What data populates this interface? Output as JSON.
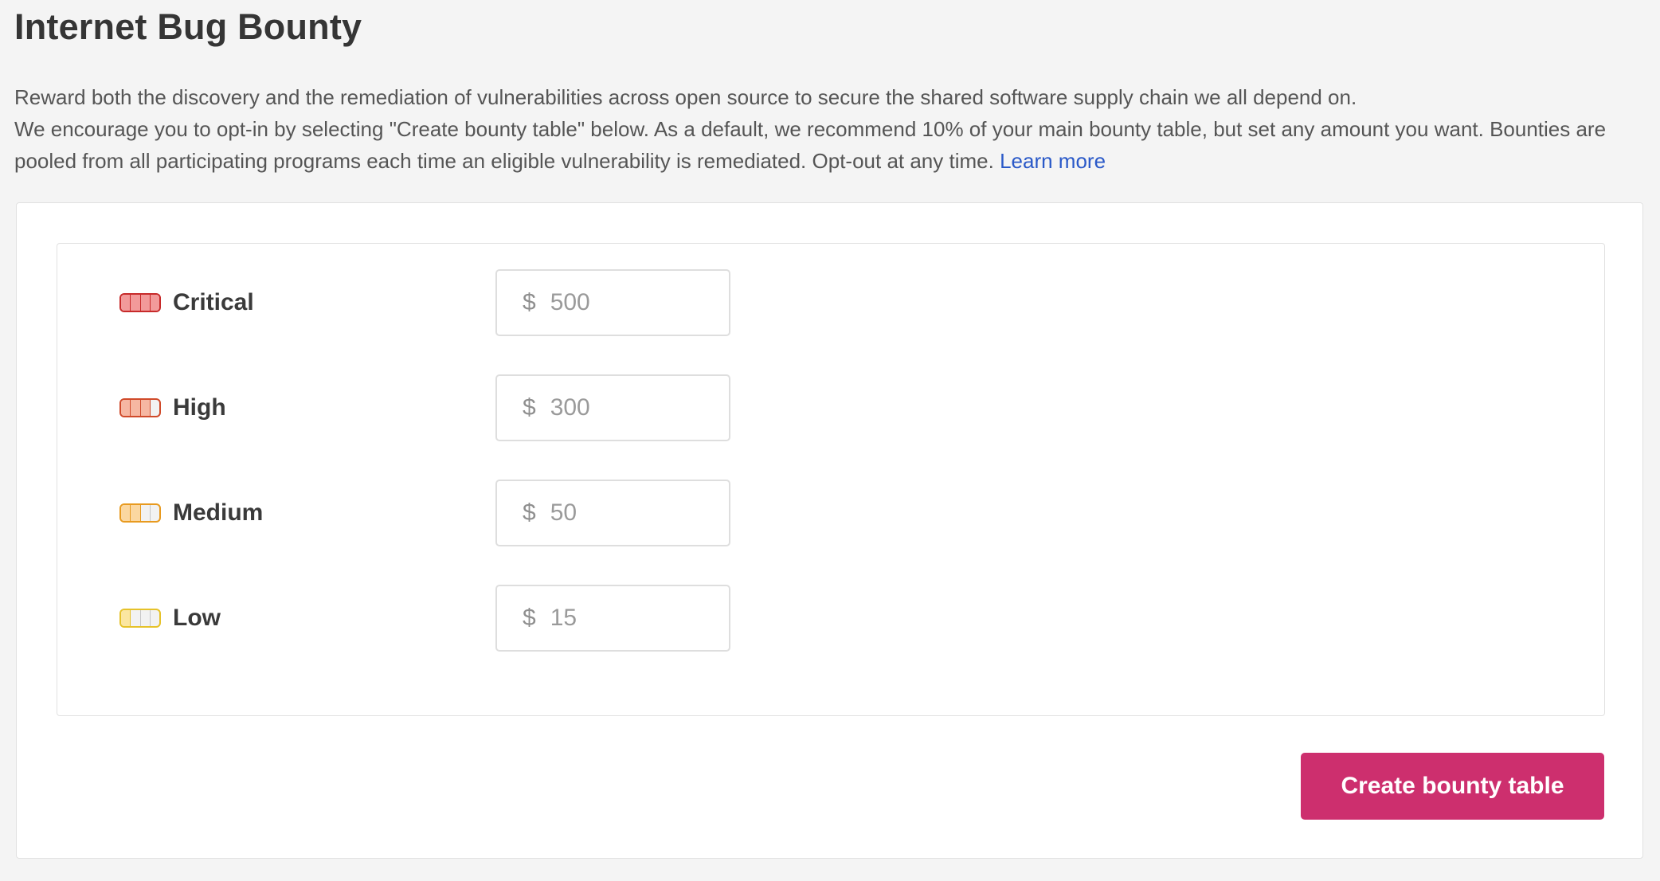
{
  "header": {
    "title": "Internet Bug Bounty"
  },
  "description": {
    "line1": "Reward both the discovery and the remediation of vulnerabilities across open source to secure the shared software supply chain we all depend on.",
    "line2": "We encourage you to opt-in by selecting \"Create bounty table\" below. As a default, we recommend 10% of your main bounty table, but set any amount you want. Bounties are pooled from all participating programs each time an eligible vulnerability is remediated. Opt-out at any time.",
    "learn_more": "Learn more"
  },
  "bounty_table": {
    "currency": "$",
    "rows": [
      {
        "severity": "Critical",
        "icon": "severity-critical-icon",
        "placeholder": "500",
        "filled_segments": 4,
        "fill_color": "#f29a9a",
        "border_color": "#c72a2a"
      },
      {
        "severity": "High",
        "icon": "severity-high-icon",
        "placeholder": "300",
        "filled_segments": 3,
        "fill_color": "#f6b7a2",
        "border_color": "#d04a2a"
      },
      {
        "severity": "Medium",
        "icon": "severity-medium-icon",
        "placeholder": "50",
        "filled_segments": 2,
        "fill_color": "#fbd7a0",
        "border_color": "#e89a1f"
      },
      {
        "severity": "Low",
        "icon": "severity-low-icon",
        "placeholder": "15",
        "filled_segments": 1,
        "fill_color": "#fbe6a0",
        "border_color": "#e6c22a"
      }
    ]
  },
  "actions": {
    "create_label": "Create bounty table",
    "create_color": "#cd2f6e"
  }
}
